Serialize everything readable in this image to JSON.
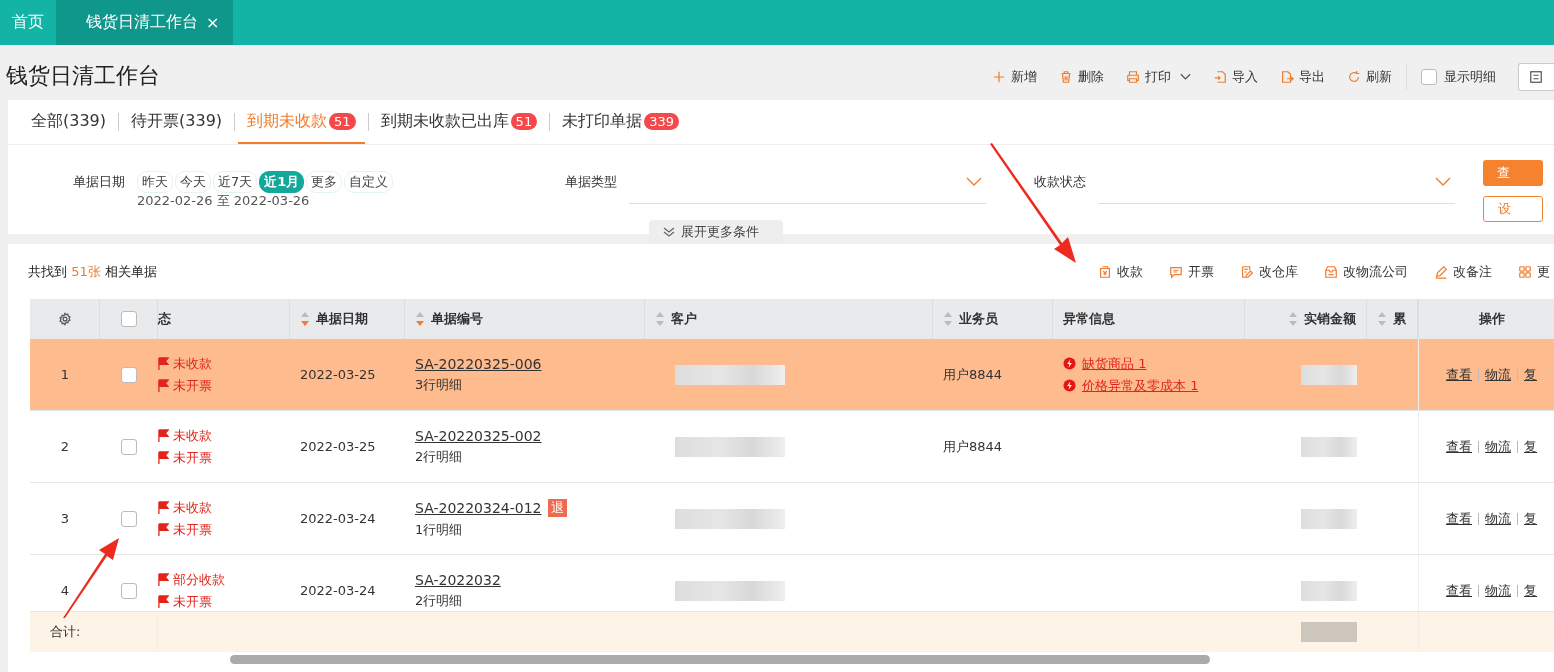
{
  "nav_tabs": [
    {
      "label": "首页",
      "selected": false
    },
    {
      "label": "钱货日清工作台",
      "selected": true,
      "close": "×"
    }
  ],
  "page_title": "钱货日清工作台",
  "toolbar": [
    {
      "label": "新增",
      "kind": "button"
    },
    {
      "label": "删除",
      "kind": "button"
    },
    {
      "label": "打印",
      "kind": "dropdown"
    },
    {
      "label": "导入",
      "kind": "button"
    },
    {
      "label": "导出",
      "kind": "button"
    },
    {
      "label": "刷新",
      "kind": "button"
    }
  ],
  "show_detail": {
    "label": "显示明细",
    "checked": false
  },
  "filter_tabs": [
    {
      "label": "全部(339)",
      "selected": false
    },
    {
      "label": "待开票(339)",
      "selected": false
    },
    {
      "label": "到期未收款",
      "badge": "51",
      "selected": true
    },
    {
      "label": "到期未收款已出库",
      "badge": "51",
      "selected": false
    },
    {
      "label": "未打印单据",
      "badge": "339",
      "selected": false
    }
  ],
  "filters": {
    "date_label": "单据日期",
    "presets": [
      {
        "label": "昨天",
        "selected": false
      },
      {
        "label": "今天",
        "selected": false
      },
      {
        "label": "近7天",
        "selected": false
      },
      {
        "label": "近1月",
        "selected": true
      },
      {
        "label": "更多",
        "selected": false
      },
      {
        "label": "自定义",
        "selected": false
      }
    ],
    "date_range": "2022-02-26 至 2022-03-26",
    "selects": [
      {
        "label": "单据类型"
      },
      {
        "label": "收款状态"
      }
    ],
    "expand": "展开更多条件",
    "query_button": "查",
    "settings_button": "设"
  },
  "result_summary": {
    "prefix": "共找到",
    "count": "51张",
    "suffix": "相关单据"
  },
  "actions": [
    {
      "label": "收款"
    },
    {
      "label": "开票"
    },
    {
      "label": "改仓库"
    },
    {
      "label": "改物流公司"
    },
    {
      "label": "改备注"
    },
    {
      "label": "更"
    }
  ],
  "table": {
    "columns": [
      {
        "kind": "settings"
      },
      {
        "kind": "checkbox",
        "checked": false
      },
      {
        "kind": "text",
        "label": "态"
      },
      {
        "kind": "sortable",
        "label": "单据日期",
        "sorted": true
      },
      {
        "kind": "sortable",
        "label": "单据编号",
        "sorted": true
      },
      {
        "kind": "sortable",
        "label": "客户",
        "sorted": false
      },
      {
        "kind": "sortable",
        "label": "业务员",
        "sorted": false
      },
      {
        "kind": "text",
        "label": "异常信息"
      },
      {
        "kind": "sortable",
        "label": "实销金额",
        "sorted": false
      },
      {
        "kind": "sortable",
        "label": "累",
        "sorted": false
      },
      {
        "kind": "text",
        "label": "操作"
      }
    ],
    "rows": [
      {
        "index": "1",
        "selected": true,
        "checked": false,
        "statuses": [
          "未收款",
          "未开票"
        ],
        "date": "2022-03-25",
        "number": "SA-20220325-006",
        "lines": "3行明细",
        "salesman": "用户8844",
        "anomalies": [
          "缺货商品 1",
          "价格异常及零成本 1"
        ],
        "ops": [
          "查看",
          "物流",
          "复"
        ]
      },
      {
        "index": "2",
        "selected": false,
        "checked": false,
        "statuses": [
          "未收款",
          "未开票"
        ],
        "date": "2022-03-25",
        "number": "SA-20220325-002",
        "lines": "2行明细",
        "salesman": "用户8844",
        "ops": [
          "查看",
          "物流",
          "复"
        ]
      },
      {
        "index": "3",
        "selected": false,
        "checked": false,
        "statuses": [
          "未收款",
          "未开票"
        ],
        "date": "2022-03-24",
        "number": "SA-20220324-012",
        "tag": "退",
        "lines": "1行明细",
        "ops": [
          "查看",
          "物流",
          "复"
        ]
      },
      {
        "index": "4",
        "selected": false,
        "checked": false,
        "statuses": [
          "部分收款",
          "未开票"
        ],
        "date": "2022-03-24",
        "number": "SA-2022032",
        "lines": "2行明细",
        "ops": [
          "查看",
          "物流",
          "复"
        ]
      }
    ],
    "total_label": "合计:"
  }
}
